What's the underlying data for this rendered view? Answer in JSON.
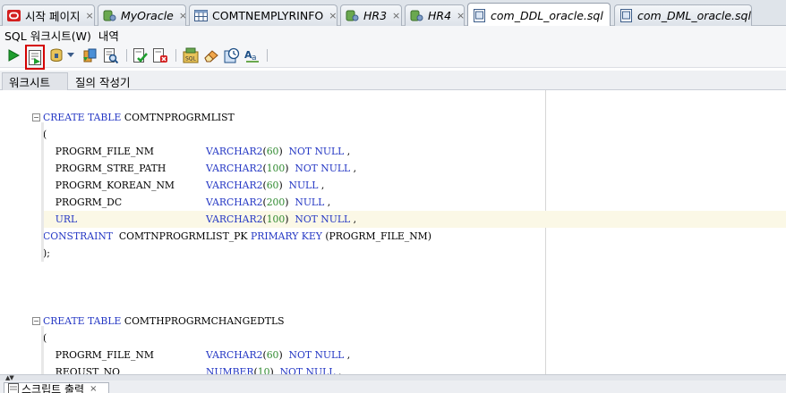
{
  "editor_tabs": [
    {
      "label": "시작 페이지",
      "italic": false,
      "icon": "oracle-icon"
    },
    {
      "label": "MyOracle",
      "italic": true,
      "icon": "connection-icon"
    },
    {
      "label": "COMTNEMPLYRINFO",
      "italic": false,
      "icon": "table-icon"
    },
    {
      "label": "HR3",
      "italic": true,
      "icon": "connection-icon"
    },
    {
      "label": "HR4",
      "italic": true,
      "icon": "connection-icon"
    },
    {
      "label": "com_DDL_oracle.sql",
      "italic": true,
      "icon": "sql-file-icon",
      "active": true
    },
    {
      "label": "com_DML_oracle.sql",
      "italic": true,
      "icon": "sql-file-icon"
    }
  ],
  "tab_close_glyph": "×",
  "worksheet_menu": {
    "worksheet": "SQL 워크시트(W)",
    "history": "내역"
  },
  "subtabs": {
    "worksheet": "워크시트",
    "query_builder": "질의 작성기"
  },
  "code": [
    {
      "text": "CREATE TABLE COMTNPROGRMLIST",
      "tokens": [
        [
          "kw",
          "CREATE TABLE"
        ],
        [
          "pl",
          " COMTNPROGRMLIST"
        ]
      ],
      "fold": true
    },
    {
      "text": "(",
      "tokens": [
        [
          "pl",
          "("
        ]
      ]
    },
    {
      "tokens": [
        [
          "pl",
          "    PROGRM_FILE_NM"
        ],
        [
          "tab",
          ""
        ],
        [
          "ty",
          "VARCHAR2"
        ],
        [
          "pl",
          "("
        ],
        [
          "nu",
          "60"
        ],
        [
          "pl",
          ")  "
        ],
        [
          "kw",
          "NOT NULL"
        ],
        [
          "pl",
          " ,"
        ]
      ]
    },
    {
      "tokens": [
        [
          "pl",
          "    PROGRM_STRE_PATH"
        ],
        [
          "tab",
          ""
        ],
        [
          "ty",
          "VARCHAR2"
        ],
        [
          "pl",
          "("
        ],
        [
          "nu",
          "100"
        ],
        [
          "pl",
          ")  "
        ],
        [
          "kw",
          "NOT NULL"
        ],
        [
          "pl",
          " ,"
        ]
      ]
    },
    {
      "tokens": [
        [
          "pl",
          "    PROGRM_KOREAN_NM"
        ],
        [
          "tab",
          ""
        ],
        [
          "ty",
          "VARCHAR2"
        ],
        [
          "pl",
          "("
        ],
        [
          "nu",
          "60"
        ],
        [
          "pl",
          ")  "
        ],
        [
          "kw",
          "NULL"
        ],
        [
          "pl",
          " ,"
        ]
      ]
    },
    {
      "tokens": [
        [
          "pl",
          "    PROGRM_DC"
        ],
        [
          "tab",
          ""
        ],
        [
          "ty",
          "VARCHAR2"
        ],
        [
          "pl",
          "("
        ],
        [
          "nu",
          "200"
        ],
        [
          "pl",
          ")  "
        ],
        [
          "kw",
          "NULL"
        ],
        [
          "pl",
          " ,"
        ]
      ]
    },
    {
      "tokens": [
        [
          "ty",
          "    URL"
        ],
        [
          "tab",
          ""
        ],
        [
          "ty",
          "VARCHAR2"
        ],
        [
          "pl",
          "("
        ],
        [
          "nu",
          "100"
        ],
        [
          "pl",
          ")  "
        ],
        [
          "kw",
          "NOT NULL"
        ],
        [
          "pl",
          " ,"
        ]
      ],
      "highlight": true
    },
    {
      "tokens": [
        [
          "kw",
          "CONSTRAINT"
        ],
        [
          "pl",
          "  COMTNPROGRMLIST_PK "
        ],
        [
          "kw",
          "PRIMARY KEY"
        ],
        [
          "pl",
          " (PROGRM_FILE_NM)"
        ]
      ]
    },
    {
      "tokens": [
        [
          "pl",
          ");"
        ]
      ]
    },
    {
      "tokens": []
    },
    {
      "tokens": []
    },
    {
      "tokens": []
    },
    {
      "tokens": [
        [
          "kw",
          "CREATE TABLE"
        ],
        [
          "pl",
          " COMTHPROGRMCHANGEDTLS"
        ]
      ],
      "fold": true
    },
    {
      "tokens": [
        [
          "pl",
          "("
        ]
      ]
    },
    {
      "tokens": [
        [
          "pl",
          "    PROGRM_FILE_NM"
        ],
        [
          "tab",
          ""
        ],
        [
          "ty",
          "VARCHAR2"
        ],
        [
          "pl",
          "("
        ],
        [
          "nu",
          "60"
        ],
        [
          "pl",
          ")  "
        ],
        [
          "kw",
          "NOT NULL"
        ],
        [
          "pl",
          " ,"
        ]
      ]
    },
    {
      "tokens": [
        [
          "pl",
          "    REQUST_NO"
        ],
        [
          "tab",
          ""
        ],
        [
          "ty",
          "NUMBER"
        ],
        [
          "pl",
          "("
        ],
        [
          "nu",
          "10"
        ],
        [
          "pl",
          ")  "
        ],
        [
          "kw",
          "NOT NULL"
        ],
        [
          "pl",
          " ,"
        ]
      ]
    }
  ],
  "bottom_panel": {
    "tab_label": "스크립트 출력",
    "close_glyph": "×"
  },
  "colors": {
    "keyword": "#2437c4",
    "number": "#2f8a2f",
    "highlight_line": "#fbf8e6",
    "toolbar_highlight": "#d40000"
  }
}
